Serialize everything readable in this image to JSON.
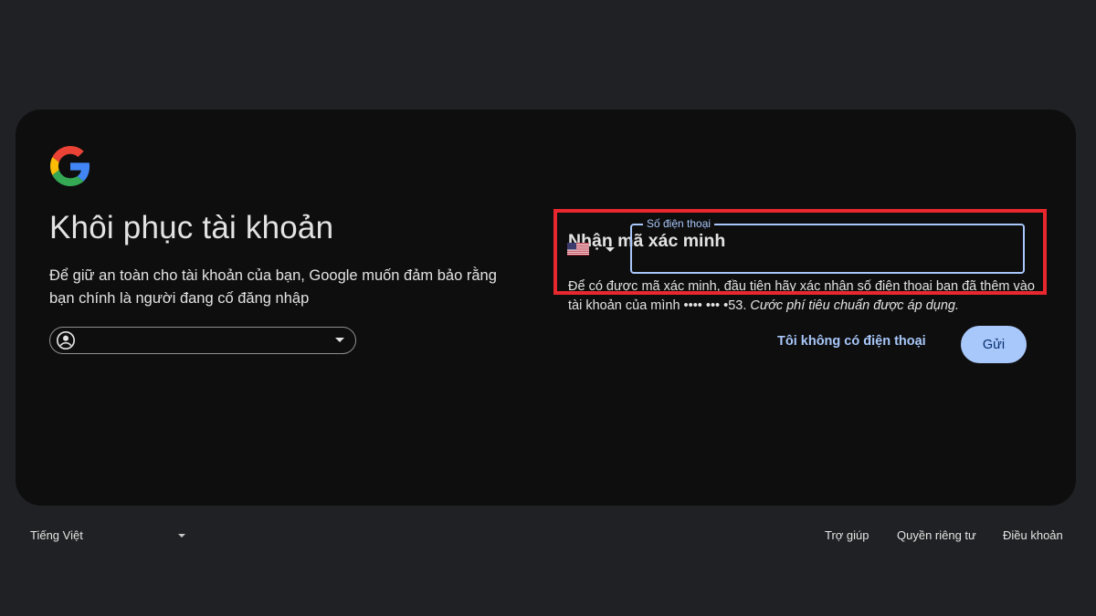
{
  "page": {
    "title": "Khôi phục tài khoản",
    "subtitle": "Để giữ an toàn cho tài khoản của bạn, Google muốn đảm bảo rằng bạn chính là người đang cố đăng nhập",
    "account_chip": {
      "email": ""
    }
  },
  "verification": {
    "heading": "Nhận mã xác minh",
    "description": "Để có được mã xác minh, đầu tiên hãy xác nhận số điện thoại bạn đã thêm vào tài khoản của mình •••• ••• •53.",
    "description_note": "Cước phí tiêu chuẩn được áp dụng.",
    "country_icon": "us-flag-icon",
    "phone_label": "Số điện thoại",
    "phone_value": "",
    "no_phone_link": "Tôi không có điện thoại",
    "send_label": "Gửi"
  },
  "footer": {
    "language": "Tiếng Việt",
    "links": [
      "Trợ giúp",
      "Quyền riêng tư",
      "Điều khoản"
    ]
  },
  "colors": {
    "background": "#202124",
    "card": "#0e0e0e",
    "accent": "#a8c7fa",
    "highlight": "#e8282e",
    "text": "#e3e3e3"
  }
}
